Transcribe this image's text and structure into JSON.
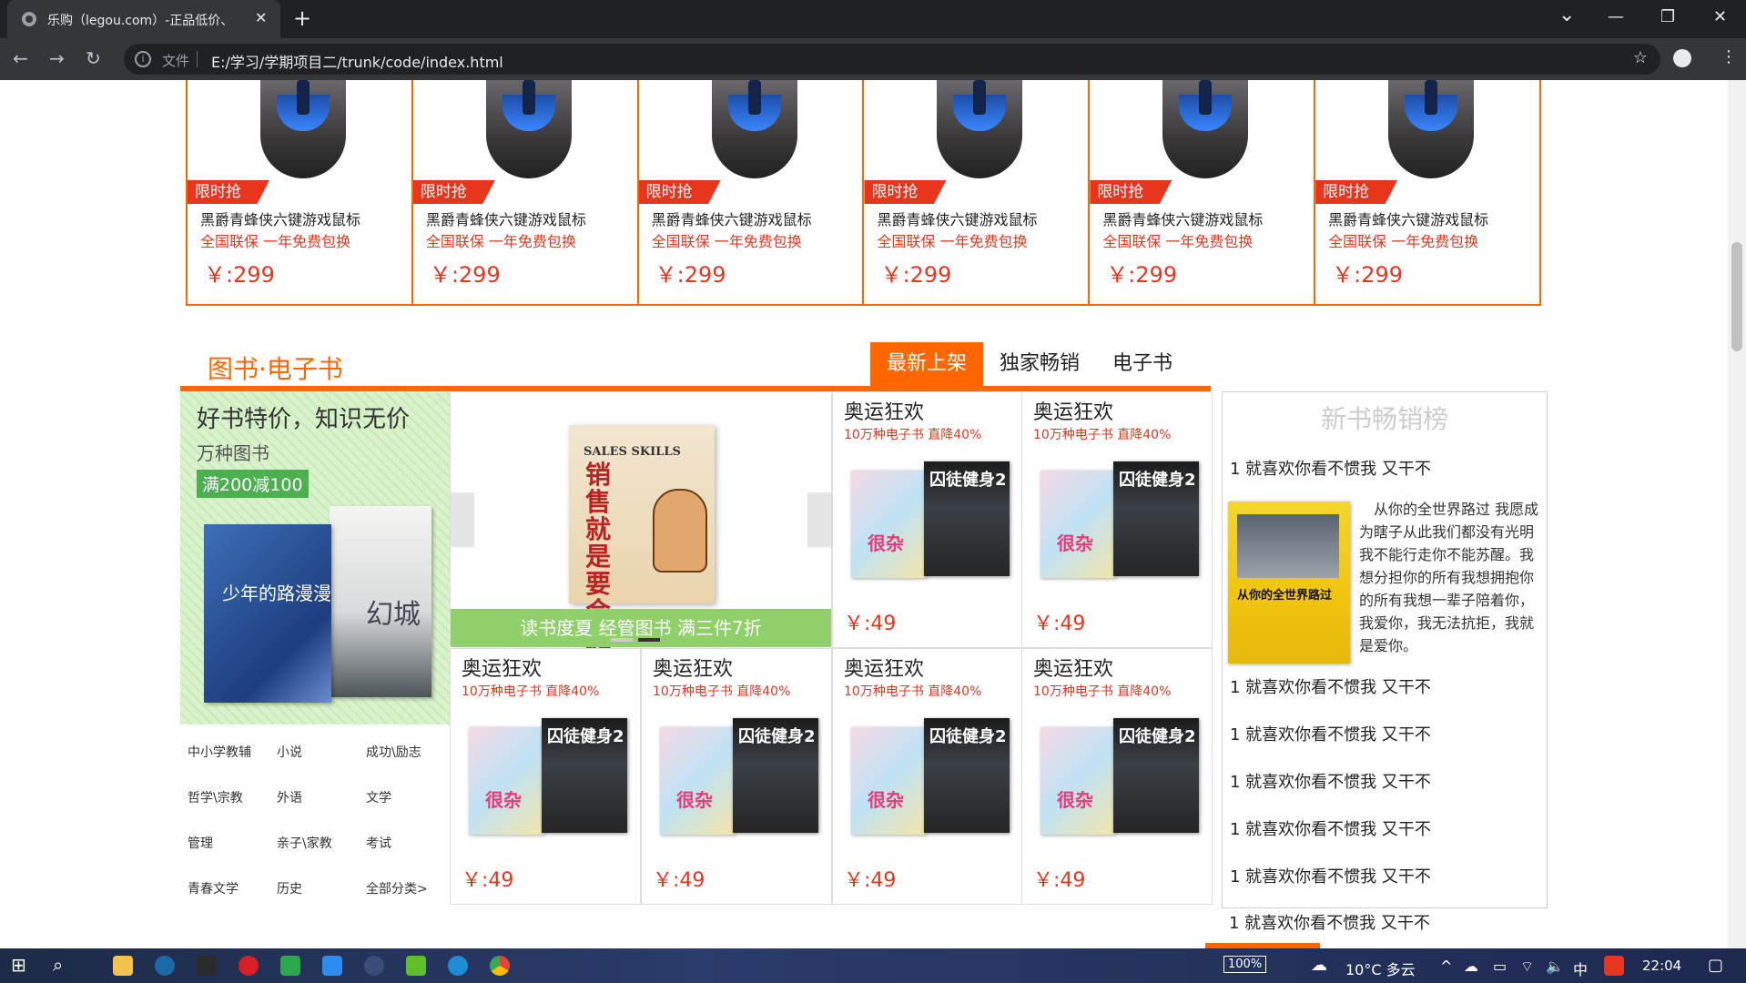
{
  "browser": {
    "tab_title": "乐购（legou.com）-正品低价、",
    "tab_close": "✕",
    "new_tab": "+",
    "address_label": "文件",
    "url": "E:/学习/学期项目二/trunk/code/index.html",
    "star": "☆",
    "min": "—",
    "max": "❐",
    "close": "✕",
    "chevron": "⌄"
  },
  "products": {
    "items": [
      {
        "flash": "限时抢",
        "name": "黑爵青蜂侠六键游戏鼠标",
        "desc": "全国联保 一年免费包换",
        "price": "￥:299"
      },
      {
        "flash": "限时抢",
        "name": "黑爵青蜂侠六键游戏鼠标",
        "desc": "全国联保 一年免费包换",
        "price": "￥:299"
      },
      {
        "flash": "限时抢",
        "name": "黑爵青蜂侠六键游戏鼠标",
        "desc": "全国联保 一年免费包换",
        "price": "￥:299"
      },
      {
        "flash": "限时抢",
        "name": "黑爵青蜂侠六键游戏鼠标",
        "desc": "全国联保 一年免费包换",
        "price": "￥:299"
      },
      {
        "flash": "限时抢",
        "name": "黑爵青蜂侠六键游戏鼠标",
        "desc": "全国联保 一年免费包换",
        "price": "￥:299"
      },
      {
        "flash": "限时抢",
        "name": "黑爵青蜂侠六键游戏鼠标",
        "desc": "全国联保 一年免费包换",
        "price": "￥:299"
      }
    ]
  },
  "books": {
    "title": "图书·电子书",
    "tabs": [
      "最新上架",
      "独家畅销",
      "电子书"
    ],
    "promo": {
      "headline": "好书特价，知识无价",
      "subline": "万种图书",
      "badge": "满200减100",
      "book1_text": "少年的路漫漫",
      "book2_text": "幻城"
    },
    "categories": [
      "中小学教辅",
      "小说",
      "成功\\励志",
      "哲学\\宗教",
      "外语",
      "文学",
      "管理",
      "亲子\\家教",
      "考试",
      "青春文学",
      "历史",
      "全部分类>"
    ],
    "carousel": {
      "book_en": "SALES SKILLS",
      "book_cn": "销售就是要会提问",
      "caption": "读书度夏 经管图书 满三件7折"
    },
    "grid": [
      {
        "title": "奥运狂欢",
        "sub": "10万种电子书 直降40%",
        "price": "￥:49",
        "cover_a": "很杂",
        "cover_b": "囚徒健身2"
      },
      {
        "title": "奥运狂欢",
        "sub": "10万种电子书 直降40%",
        "price": "￥:49",
        "cover_a": "很杂",
        "cover_b": "囚徒健身2"
      },
      {
        "title": "奥运狂欢",
        "sub": "10万种电子书 直降40%",
        "price": "￥:49",
        "cover_a": "很杂",
        "cover_b": "囚徒健身2"
      },
      {
        "title": "奥运狂欢",
        "sub": "10万种电子书 直降40%",
        "price": "￥:49",
        "cover_a": "很杂",
        "cover_b": "囚徒健身2"
      },
      {
        "title": "奥运狂欢",
        "sub": "10万种电子书 直降40%",
        "price": "￥:49",
        "cover_a": "很杂",
        "cover_b": "囚徒健身2"
      },
      {
        "title": "奥运狂欢",
        "sub": "10万种电子书 直降40%",
        "price": "￥:49",
        "cover_a": "很杂",
        "cover_b": "囚徒健身2"
      }
    ]
  },
  "ranking": {
    "title": "新书畅销榜",
    "cover_text": "从你的全世界路过",
    "description": "从你的全世界路过 我愿成为瞎子从此我们都没有光明我不能行走你不能苏醒。我想分担你的所有我想拥抱你的所有我想一辈子陪着你，我爱你，我无法抗拒，我就是爱你。",
    "items": [
      "1 就喜欢你看不惯我 又干不",
      "1 就喜欢你看不惯我 又干不",
      "1 就喜欢你看不惯我 又干不",
      "1 就喜欢你看不惯我 又干不",
      "1 就喜欢你看不惯我 又干不",
      "1 就喜欢你看不惯我 又干不",
      "1 就喜欢你看不惯我 又干不"
    ]
  },
  "taskbar": {
    "battery": "100%",
    "weather": "10°C 多云",
    "ime": "中",
    "time": "22:04"
  },
  "colors": {
    "accent": "#ff6600",
    "price_red": "#e8351e",
    "promo_green": "#8fd06a"
  }
}
